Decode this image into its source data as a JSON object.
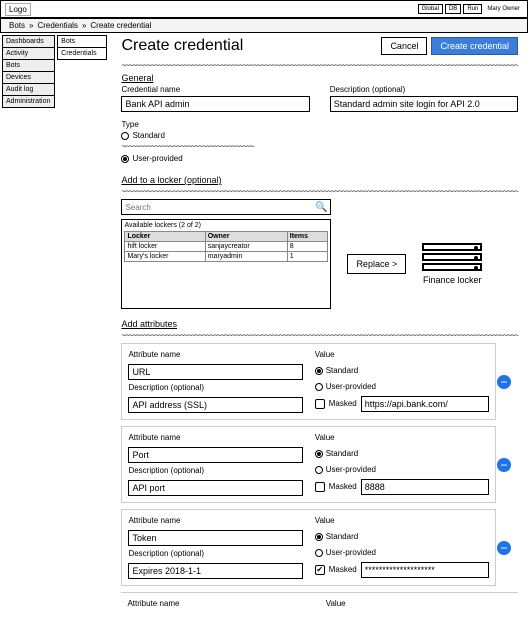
{
  "topbar": {
    "logo": "Logo",
    "btn1": "Global",
    "btn2": "DB",
    "btn3": "Run",
    "user": "Mary Owner"
  },
  "breadcrumb": {
    "a": "Bots",
    "b": "Credentials",
    "c": "Create credential"
  },
  "leftnav": {
    "dashboards": "Dashboards",
    "activity": "Activity",
    "bots": "Bots",
    "devices": "Devices",
    "auditlog": "Audit log",
    "administration": "Administration"
  },
  "subnav": {
    "bots": "Bots",
    "credentials": "Credentials"
  },
  "page": {
    "title": "Create credential",
    "cancel": "Cancel",
    "create": "Create credential"
  },
  "general": {
    "label": "General",
    "name_label": "Credential name",
    "name_value": "Bank API admin",
    "desc_label": "Description (optional)",
    "desc_value": "Standard admin site login for API 2.0",
    "type_label": "Type",
    "standard": "Standard",
    "userprovided": "User-provided"
  },
  "locker": {
    "label": "Add to a locker (optional)",
    "search_placeholder": "Search",
    "available": "Available lockers (2 of 2)",
    "col_locker": "Locker",
    "col_owner": "Owner",
    "col_items": "Items",
    "rows": [
      {
        "name": "hift locker",
        "owner": "sanjaycreator",
        "items": "8"
      },
      {
        "name": "Mary's locker",
        "owner": "maryadmin",
        "items": "1"
      }
    ],
    "replace": "Replace >",
    "selected": "Finance locker"
  },
  "attrs": {
    "label": "Add attributes",
    "name_label": "Attribute name",
    "desc_label": "Description (optional)",
    "value_label": "Value",
    "standard": "Standard",
    "userprovided": "User-provided",
    "masked": "Masked",
    "items": [
      {
        "name": "URL",
        "desc": "API address (SSL)",
        "masked": false,
        "value": "https://api.bank.com/"
      },
      {
        "name": "Port",
        "desc": "API port",
        "masked": false,
        "value": "8888"
      },
      {
        "name": "Token",
        "desc": "Expires 2018-1-1",
        "masked": true,
        "value": "********************"
      }
    ],
    "next_name_label": "Attribute name",
    "next_value_label": "Value"
  }
}
